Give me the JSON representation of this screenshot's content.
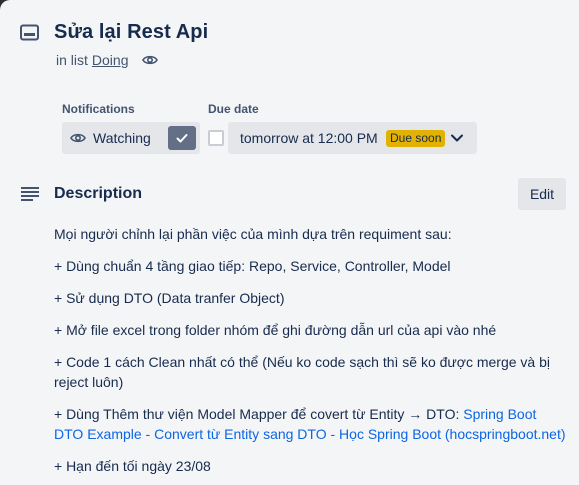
{
  "card": {
    "title": "Sửa lại Rest Api",
    "in_list_prefix": "in list",
    "list_name": "Doing"
  },
  "notifications": {
    "label": "Notifications",
    "watch_label": "Watching"
  },
  "due_date": {
    "label": "Due date",
    "value": "tomorrow at 12:00 PM",
    "badge": "Due soon",
    "badge_color": "#e2b203"
  },
  "description": {
    "title": "Description",
    "edit_label": "Edit",
    "lines": [
      "Mọi người chỉnh lại phần việc của mình dựa trên requiment sau:",
      "+ Dùng chuẩn 4 tầng giao tiếp: Repo, Service, Controller, Model",
      "+ Sử dụng DTO (Data tranfer Object)",
      "+ Mở file excel trong folder nhóm để ghi đường dẫn url của api vào nhé",
      "+ Code 1 cách Clean nhất có thể (Nếu ko code sạch thì sẽ ko được merge và bị reject luôn)"
    ],
    "mapper_prefix": "+ Dùng Thêm thư viện Model Mapper để covert từ Entity → DTO: ",
    "mapper_link": "Spring Boot DTO Example - Convert từ Entity sang DTO - Học Spring Boot (hocspringboot.net)",
    "deadline": "+ Hạn đến tối ngày 23/08"
  },
  "icons": {
    "card": "card-icon",
    "watch": "eye-icon",
    "check": "check-icon",
    "chevron": "chevron-down-icon",
    "description": "description-lines-icon"
  },
  "colors": {
    "link": "#0c66e4",
    "watch_check_bg": "#626f86"
  }
}
